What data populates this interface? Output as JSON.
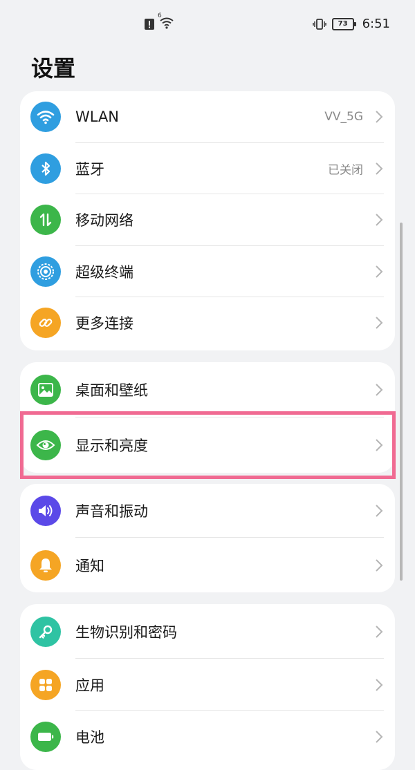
{
  "status_bar": {
    "time": "6:51",
    "battery": "73",
    "network_badge": "6",
    "icons": [
      "alert-icon",
      "wifi-icon",
      "vibrate-icon",
      "battery-icon"
    ]
  },
  "page": {
    "title": "设置"
  },
  "groups": [
    {
      "items": [
        {
          "label": "WLAN",
          "value": "VV_5G",
          "icon": "wifi-icon",
          "color": "#2f9ee0"
        },
        {
          "label": "蓝牙",
          "value": "已关闭",
          "icon": "bluetooth-icon",
          "color": "#2f9ee0"
        },
        {
          "label": "移动网络",
          "value": "",
          "icon": "mobile-data-icon",
          "color": "#3cb64a"
        },
        {
          "label": "超级终端",
          "value": "",
          "icon": "super-device-icon",
          "color": "#2f9ee0"
        },
        {
          "label": "更多连接",
          "value": "",
          "icon": "link-icon",
          "color": "#f5a524"
        }
      ]
    },
    {
      "items": [
        {
          "label": "桌面和壁纸",
          "value": "",
          "icon": "wallpaper-icon",
          "color": "#3cb64a"
        },
        {
          "label": "显示和亮度",
          "value": "",
          "icon": "eye-icon",
          "color": "#3cb64a",
          "highlighted": true
        }
      ]
    },
    {
      "items": [
        {
          "label": "声音和振动",
          "value": "",
          "icon": "sound-icon",
          "color": "#5b49e8"
        },
        {
          "label": "通知",
          "value": "",
          "icon": "bell-icon",
          "color": "#f5a524"
        }
      ]
    },
    {
      "items": [
        {
          "label": "生物识别和密码",
          "value": "",
          "icon": "key-icon",
          "color": "#2fc3a3"
        },
        {
          "label": "应用",
          "value": "",
          "icon": "apps-icon",
          "color": "#f5a524"
        },
        {
          "label": "电池",
          "value": "",
          "icon": "battery-icon",
          "color": "#3cb64a"
        }
      ]
    }
  ]
}
